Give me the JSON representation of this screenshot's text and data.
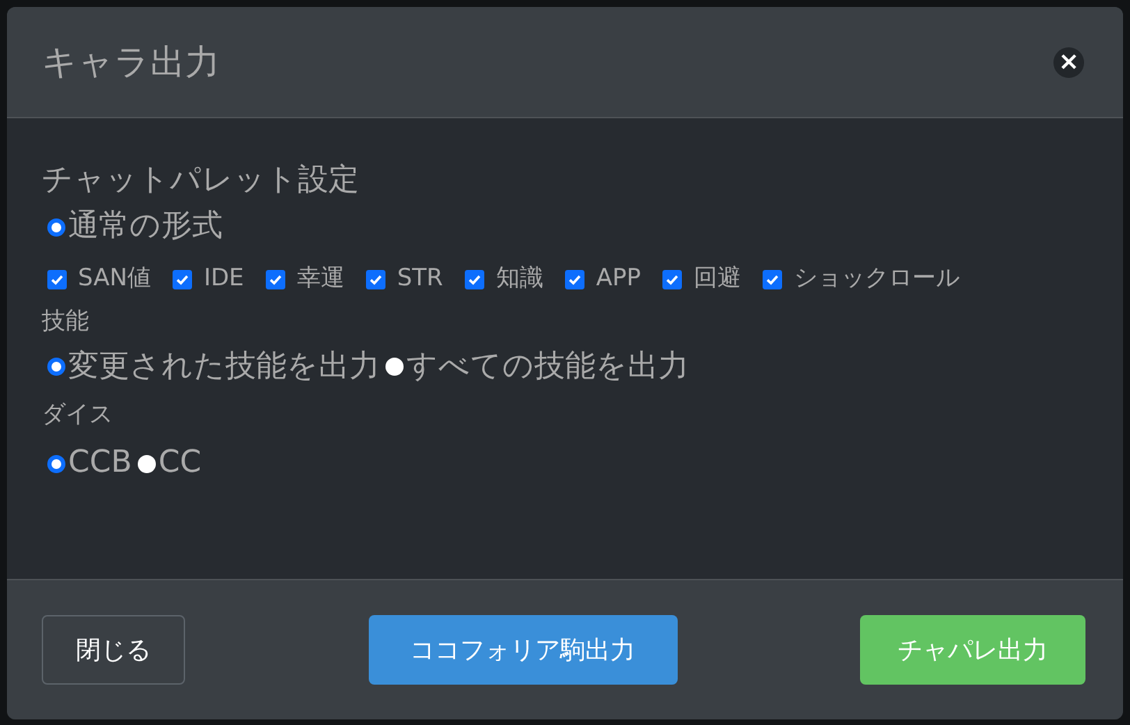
{
  "dialog": {
    "title": "キャラ出力",
    "close": "×"
  },
  "palette": {
    "heading": "チャットパレット設定",
    "format": [
      {
        "label": "通常の形式",
        "selected": true
      }
    ],
    "items": [
      {
        "label": "SAN値",
        "checked": true
      },
      {
        "label": "IDE",
        "checked": true
      },
      {
        "label": "幸運",
        "checked": true
      },
      {
        "label": "STR",
        "checked": true
      },
      {
        "label": "知識",
        "checked": true
      },
      {
        "label": "APP",
        "checked": true
      },
      {
        "label": "回避",
        "checked": true
      },
      {
        "label": "ショックロール",
        "checked": true
      }
    ]
  },
  "skills": {
    "heading": "技能",
    "options": [
      {
        "label": "変更された技能を出力",
        "selected": true
      },
      {
        "label": "すべての技能を出力",
        "selected": false
      }
    ]
  },
  "dice": {
    "heading": "ダイス",
    "options": [
      {
        "label": "CCB",
        "selected": true
      },
      {
        "label": "CC",
        "selected": false
      }
    ]
  },
  "buttons": [
    {
      "label": "閉じる",
      "kind": "secondary"
    },
    {
      "label": "ココフォリア駒出力",
      "kind": "info"
    },
    {
      "label": "チャパレ出力",
      "kind": "success"
    }
  ]
}
